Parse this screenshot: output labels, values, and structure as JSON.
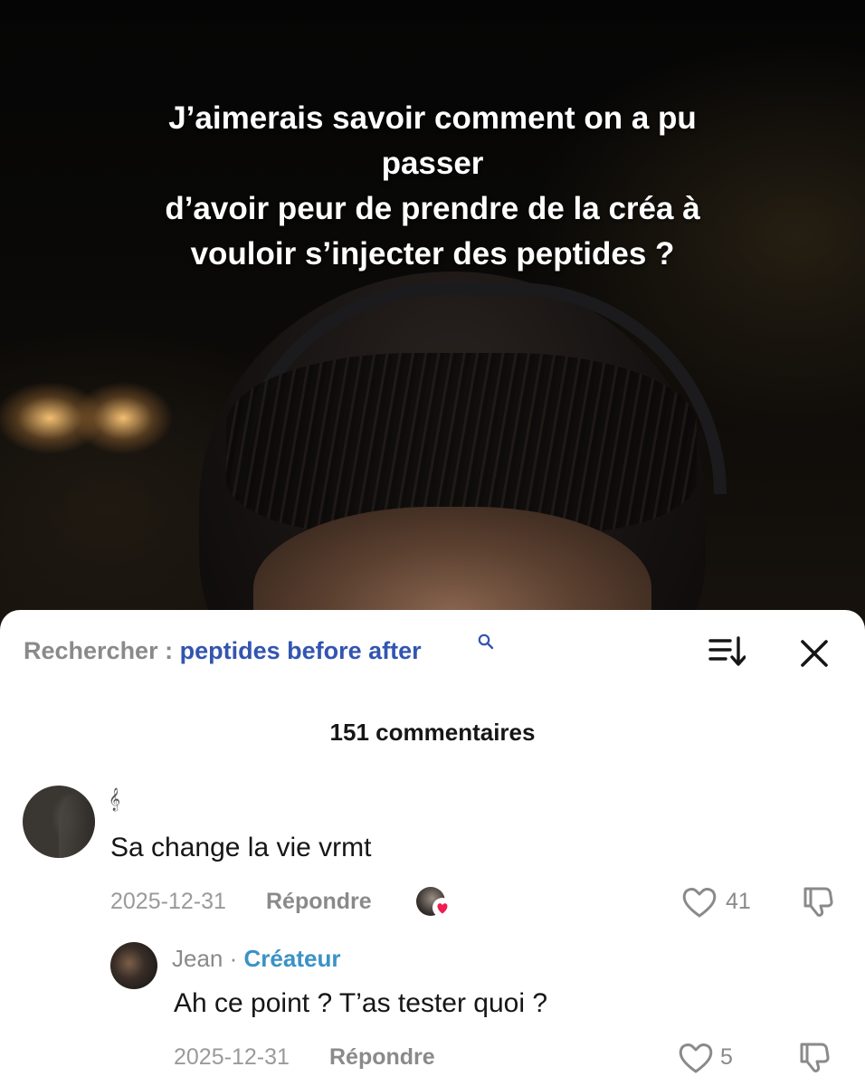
{
  "video": {
    "overlay_lines": [
      "J’aimerais savoir comment on a pu",
      "passer",
      "d’avoir peur de prendre de la créa à",
      "vouloir s’injecter des peptides ?"
    ]
  },
  "search": {
    "prefix": "Rechercher :",
    "query": "peptides before after"
  },
  "comments_header": {
    "count_label": "151 commentaires"
  },
  "comments": [
    {
      "username_glyph": "𝄞",
      "text": "Sa change la vie vrmt",
      "date": "2025-12-31",
      "reply_label": "Répondre",
      "likes": "41",
      "liked_by_creator": true
    },
    {
      "author": "Jean",
      "separator": "·",
      "badge": "Créateur",
      "text": "Ah ce point ? T’as tester quoi ?",
      "date": "2025-12-31",
      "reply_label": "Répondre",
      "likes": "5"
    }
  ],
  "colors": {
    "search_query": "#3355b0",
    "creator_badge": "#3a92c7",
    "heart_badge": "#ee1d52",
    "muted_text": "#8a8a8a"
  }
}
